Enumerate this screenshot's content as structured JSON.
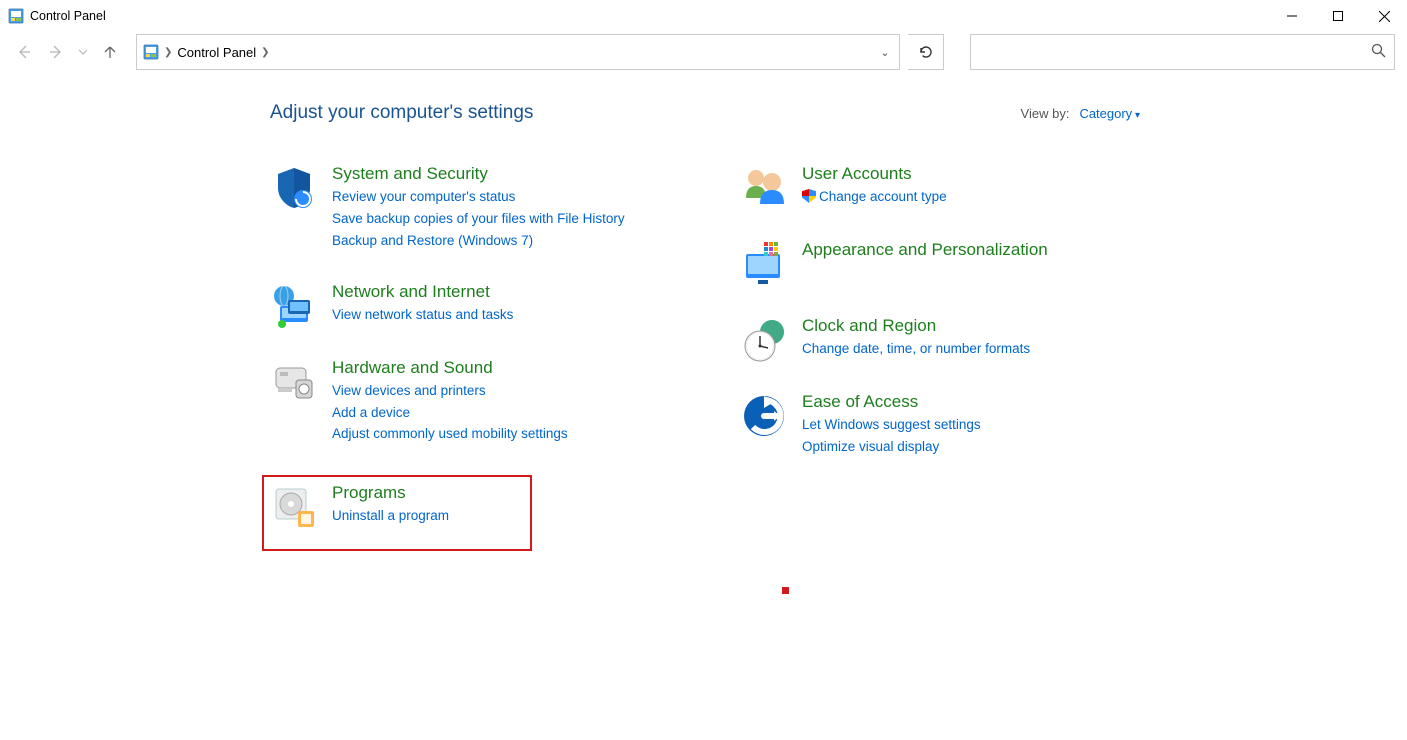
{
  "window": {
    "title": "Control Panel"
  },
  "breadcrumb": {
    "root": "Control Panel"
  },
  "search": {
    "placeholder": ""
  },
  "page": {
    "heading": "Adjust your computer's settings",
    "viewby_label": "View by:",
    "viewby_value": "Category"
  },
  "categories": {
    "system_security": {
      "title": "System and Security",
      "tasks": [
        "Review your computer's status",
        "Save backup copies of your files with File History",
        "Backup and Restore (Windows 7)"
      ]
    },
    "network": {
      "title": "Network and Internet",
      "tasks": [
        "View network status and tasks"
      ]
    },
    "hardware": {
      "title": "Hardware and Sound",
      "tasks": [
        "View devices and printers",
        "Add a device",
        "Adjust commonly used mobility settings"
      ]
    },
    "programs": {
      "title": "Programs",
      "tasks": [
        "Uninstall a program"
      ]
    },
    "users": {
      "title": "User Accounts",
      "tasks": [
        "Change account type"
      ]
    },
    "appearance": {
      "title": "Appearance and Personalization",
      "tasks": []
    },
    "clock": {
      "title": "Clock and Region",
      "tasks": [
        "Change date, time, or number formats"
      ]
    },
    "ease": {
      "title": "Ease of Access",
      "tasks": [
        "Let Windows suggest settings",
        "Optimize visual display"
      ]
    }
  }
}
